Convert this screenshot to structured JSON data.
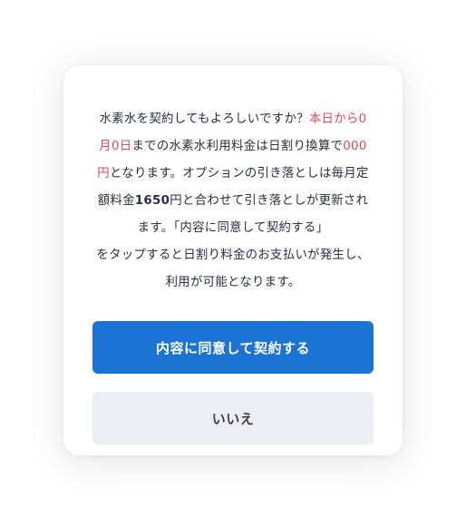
{
  "dialog": {
    "message": {
      "line1_a": "水素水を契約してもよろしいですか？",
      "line1_b": "本日から0",
      "line2_a": "月0日",
      "line2_b": "までの水素水利用料金は日割り換算で",
      "line2_c": "000",
      "line3_a": "円",
      "line3_b": "となります。オプションの引き落としは毎月定",
      "line4_a": "額料金",
      "line4_b": "1650",
      "line4_c": "円と合わせて引き落としが更新され",
      "line5": "ます。「内容に同意して契約する」",
      "line6": "をタップすると日割り料金のお支払いが発生し、",
      "line7": "利用が可能となります。"
    },
    "confirm_button": "内容に同意して契約する",
    "cancel_button": "いいえ",
    "colors": {
      "highlight": "#e34a5a",
      "primary": "#1b74d4",
      "secondary_bg": "#eceef4",
      "text": "#2a2f3f"
    }
  }
}
